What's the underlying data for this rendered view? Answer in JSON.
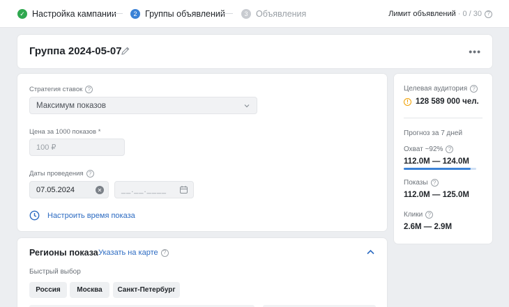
{
  "steps": [
    {
      "label": "Настройка кампании",
      "state": "done"
    },
    {
      "number": "2",
      "label": "Группы объявлений",
      "state": "active"
    },
    {
      "number": "3",
      "label": "Объявления",
      "state": "todo"
    }
  ],
  "limit": {
    "label": "Лимит объявлений",
    "value": "· 0 / 30"
  },
  "group": {
    "title": "Группа 2024-05-07"
  },
  "form": {
    "strategy_label": "Стратегия ставок",
    "strategy_value": "Максимум показов",
    "price_label": "Цена за 1000 показов *",
    "price_placeholder": "100 ₽",
    "dates_label": "Даты проведения",
    "date_start": "07.05.2024",
    "date_end_placeholder": "__.__.____",
    "time_link": "Настроить время показа"
  },
  "side": {
    "audience_label": "Целевая аудитория",
    "audience_value": "128 589 000 чел.",
    "forecast_label": "Прогноз за 7 дней",
    "reach_label": "Охват ~92%",
    "reach_value": "112.0M — 124.0M",
    "reach_fraction": 0.92,
    "impressions_label": "Показы",
    "impressions_value": "112.0M — 125.0M",
    "clicks_label": "Клики",
    "clicks_value": "2.6M — 2.9M"
  },
  "regions": {
    "title": "Регионы показа",
    "map_link": "Указать на карте",
    "quick_label": "Быстрый выбор",
    "chips": [
      "Россия",
      "Москва",
      "Санкт-Петербург"
    ]
  },
  "colors": {
    "accent": "#3b82d6",
    "success": "#2fa84f",
    "warning": "#f0a000",
    "link": "#2c6bc2"
  }
}
